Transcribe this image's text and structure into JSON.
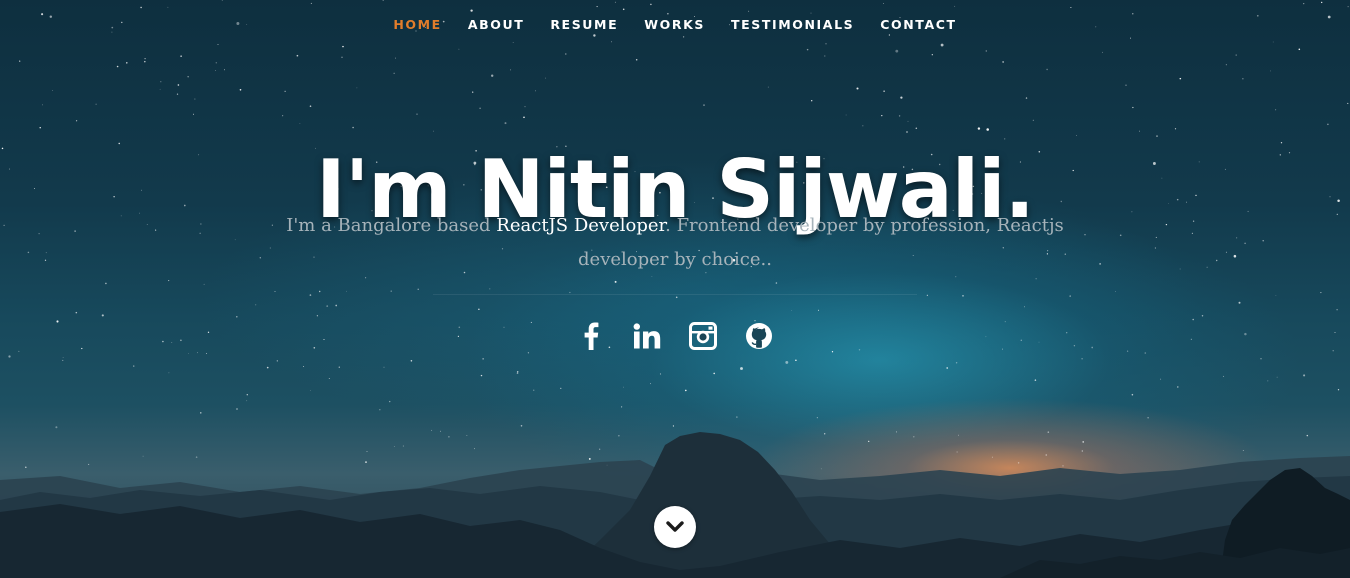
{
  "nav": {
    "items": [
      {
        "label": "HOME",
        "active": true
      },
      {
        "label": "ABOUT",
        "active": false
      },
      {
        "label": "RESUME",
        "active": false
      },
      {
        "label": "WORKS",
        "active": false
      },
      {
        "label": "TESTIMONIALS",
        "active": false
      },
      {
        "label": "CONTACT",
        "active": false
      }
    ],
    "active_color": "#e27d2b"
  },
  "hero": {
    "title": "I'm Nitin Sijwali.",
    "intro_before": "I'm a Bangalore based ",
    "intro_highlight": "ReactJS Developer",
    "intro_after": ". Frontend developer by profession, Reactjs developer by choice.."
  },
  "social": [
    {
      "icon": "facebook-icon"
    },
    {
      "icon": "linkedin-icon"
    },
    {
      "icon": "instagram-icon"
    },
    {
      "icon": "github-icon"
    }
  ],
  "scroll_down": {
    "icon": "chevron-down-icon"
  }
}
